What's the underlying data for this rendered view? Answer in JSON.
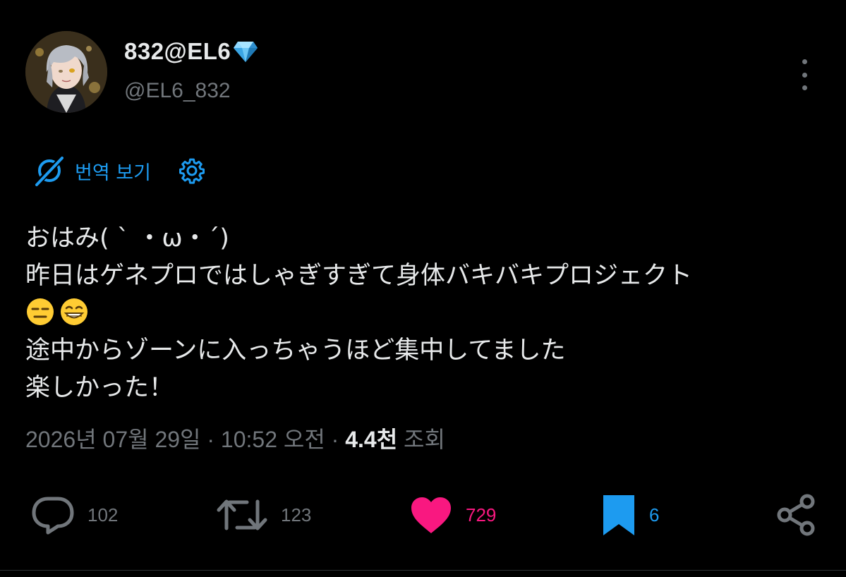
{
  "author": {
    "name": "832@EL6",
    "handle": "@EL6_832",
    "badge_icon": "gem-emoji"
  },
  "translate": {
    "label": "번역 보기",
    "icon": "translate-off-icon",
    "settings_icon": "gear-icon"
  },
  "tweet": {
    "lines": [
      "おはみ( ˋ ・ω・ˊ)",
      "昨日はゲネプロではしゃぎすぎて身体バキバキプロジェクト",
      "",
      "途中からゾーンに入っちゃうほど集中してました",
      "楽しかった！"
    ],
    "emojis": [
      "expressionless-face-emoji",
      "grinning-face-emoji"
    ]
  },
  "meta": {
    "date": "2026년 07월 29일",
    "time": "10:52 오전",
    "views_count": "4.4천",
    "views_label": "조회",
    "separator": "·"
  },
  "actions": {
    "reply": {
      "count": "102",
      "icon": "reply-icon"
    },
    "retweet": {
      "count": "123",
      "icon": "retweet-icon"
    },
    "like": {
      "count": "729",
      "icon": "heart-icon",
      "active": true
    },
    "bookmark": {
      "count": "6",
      "icon": "bookmark-icon",
      "active": true
    },
    "share": {
      "icon": "share-icon"
    }
  },
  "colors": {
    "background": "#000000",
    "text_primary": "#e7e9ea",
    "text_secondary": "#71767b",
    "accent_blue": "#1d9bf0",
    "like_pink": "#f91880"
  }
}
